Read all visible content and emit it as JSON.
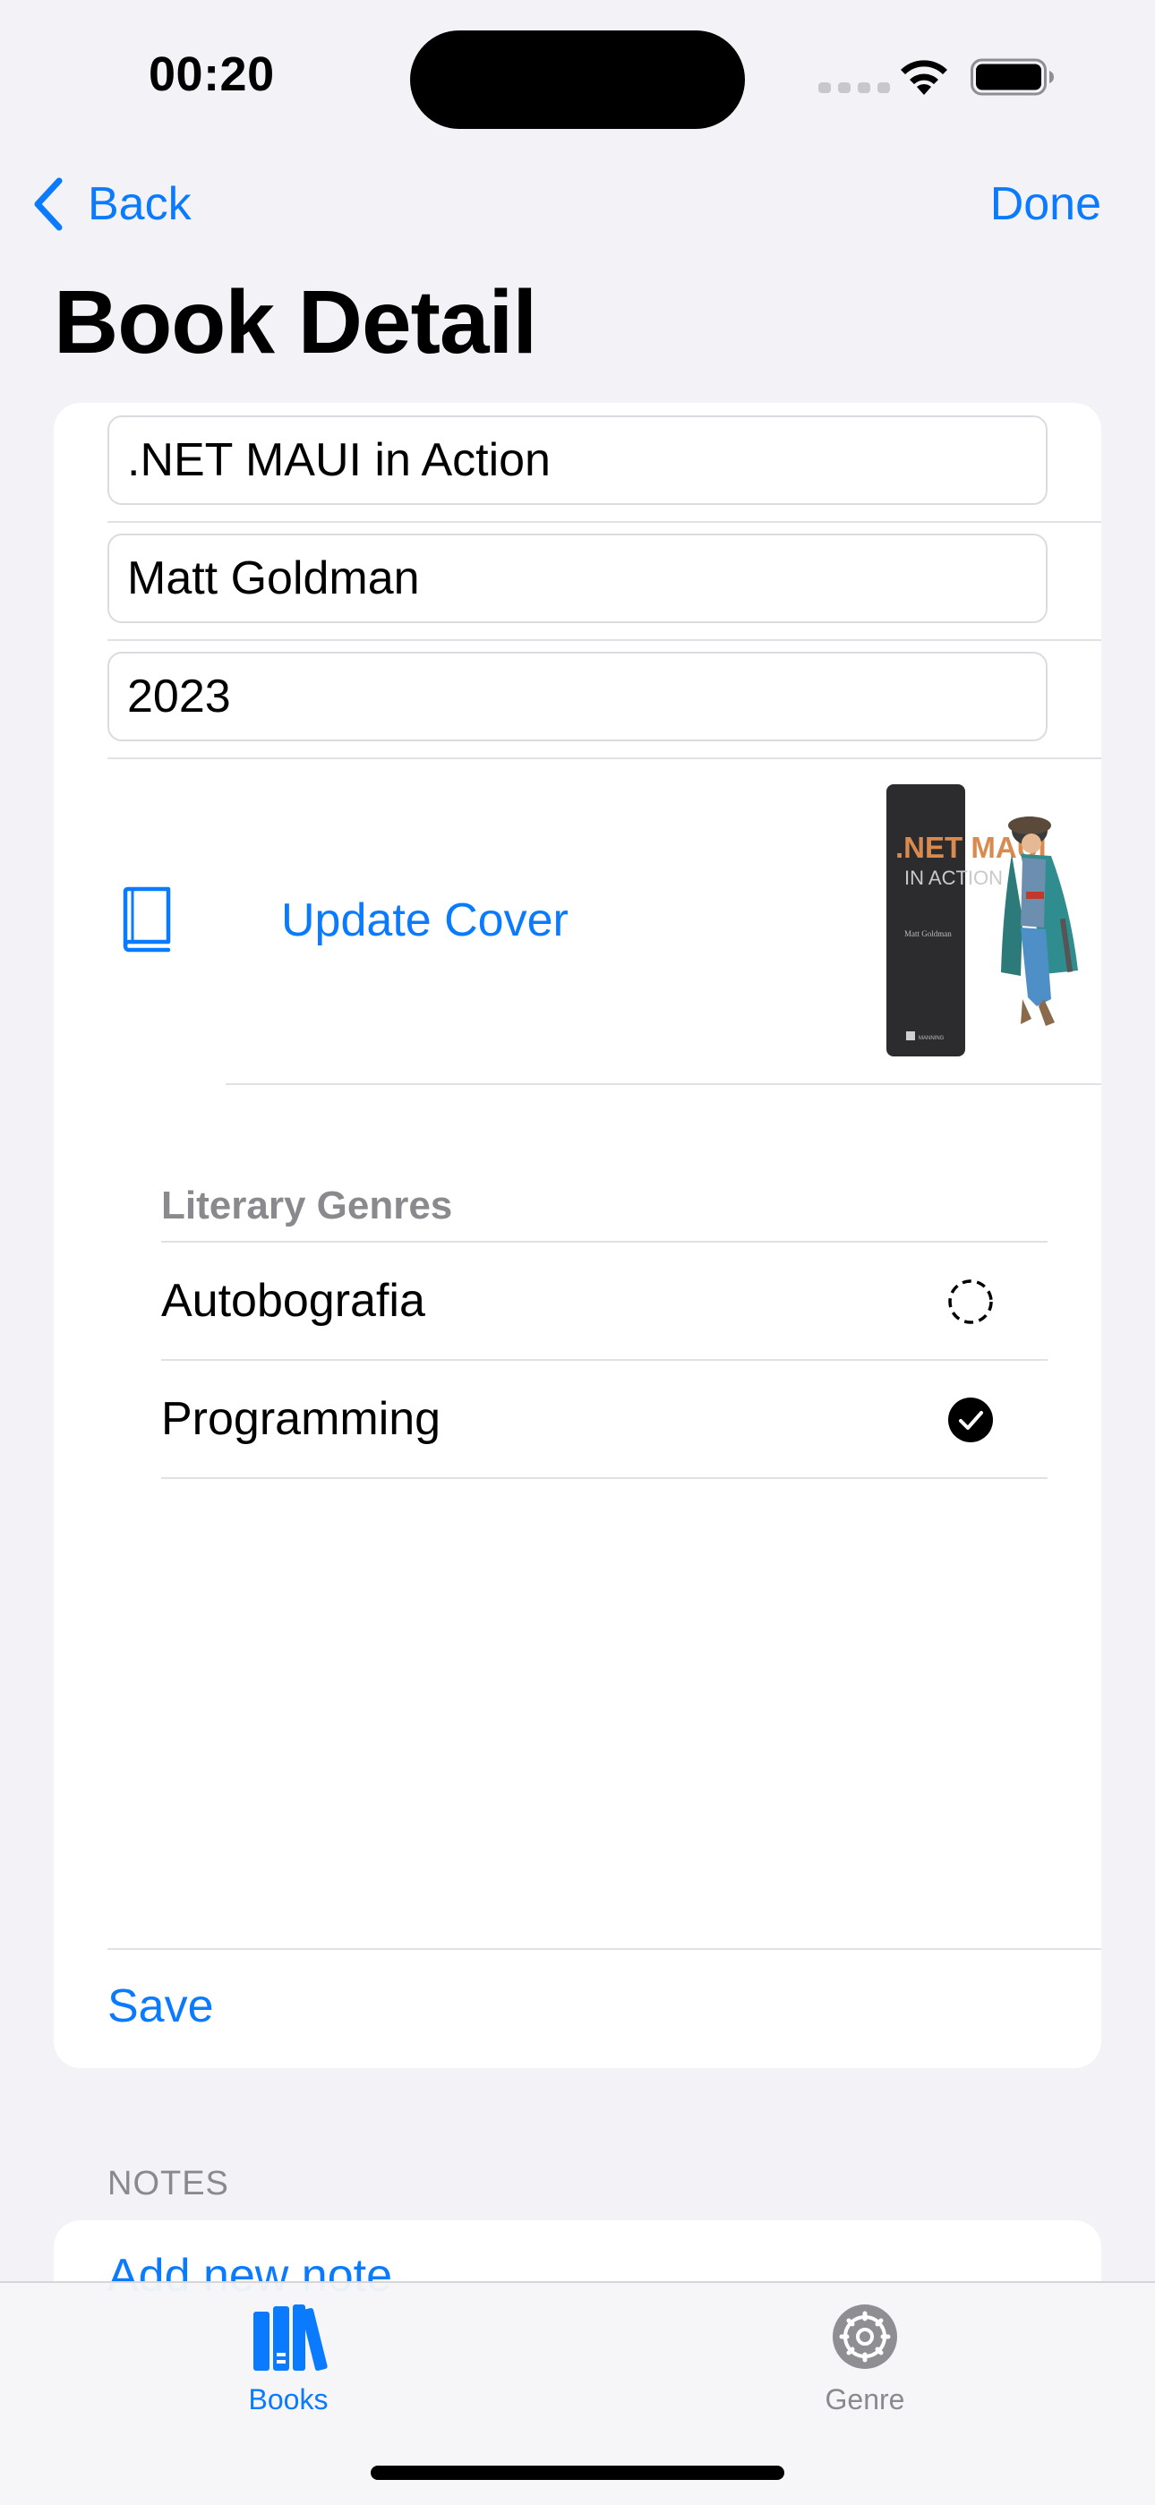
{
  "status_bar": {
    "time": "00:20"
  },
  "nav": {
    "back_label": "Back",
    "done_label": "Done",
    "title": "Book Detail"
  },
  "fields": {
    "title_value": ".NET MAUI in Action",
    "author_value": "Matt Goldman",
    "year_value": "2023"
  },
  "cover": {
    "update_label": "Update Cover",
    "icon": "book-icon",
    "image_text_title": ".NET MAUI",
    "image_text_subtitle": "IN ACTION",
    "image_text_author": "Matt Goldman",
    "image_text_publisher": "MANNING"
  },
  "genres": {
    "header": "Literary Genres",
    "items": [
      {
        "label": "Autobografia",
        "selected": false
      },
      {
        "label": "Programming",
        "selected": true
      }
    ]
  },
  "actions": {
    "save_label": "Save"
  },
  "notes": {
    "header": "NOTES",
    "add_label": "Add new note"
  },
  "tab_bar": {
    "tabs": [
      {
        "label": "Books",
        "icon": "books-icon",
        "active": true
      },
      {
        "label": "Genre",
        "icon": "gear-icon",
        "active": false
      }
    ]
  },
  "colors": {
    "accent": "#0a7aff",
    "background": "#f2f2f7",
    "secondary_text": "#8a8a8e"
  }
}
